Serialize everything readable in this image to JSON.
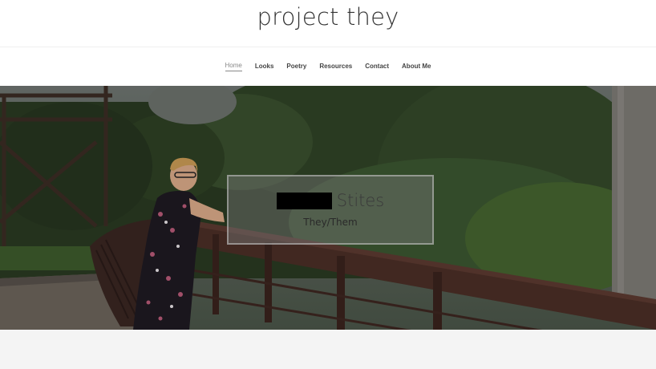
{
  "site": {
    "title": "project they"
  },
  "nav": {
    "items": [
      {
        "label": "Home",
        "active": true
      },
      {
        "label": "Looks",
        "active": false
      },
      {
        "label": "Poetry",
        "active": false
      },
      {
        "label": "Resources",
        "active": false
      },
      {
        "label": "Contact",
        "active": false
      },
      {
        "label": "About Me",
        "active": false
      }
    ]
  },
  "hero": {
    "name": "Stites",
    "pronouns": "They/Them"
  },
  "colors": {
    "title_text": "#333333",
    "nav_text": "#444444",
    "nav_active": "#888888",
    "foliage": "#2c3a24",
    "railing": "#4a2e26",
    "footer_band": "#f4f4f4"
  }
}
